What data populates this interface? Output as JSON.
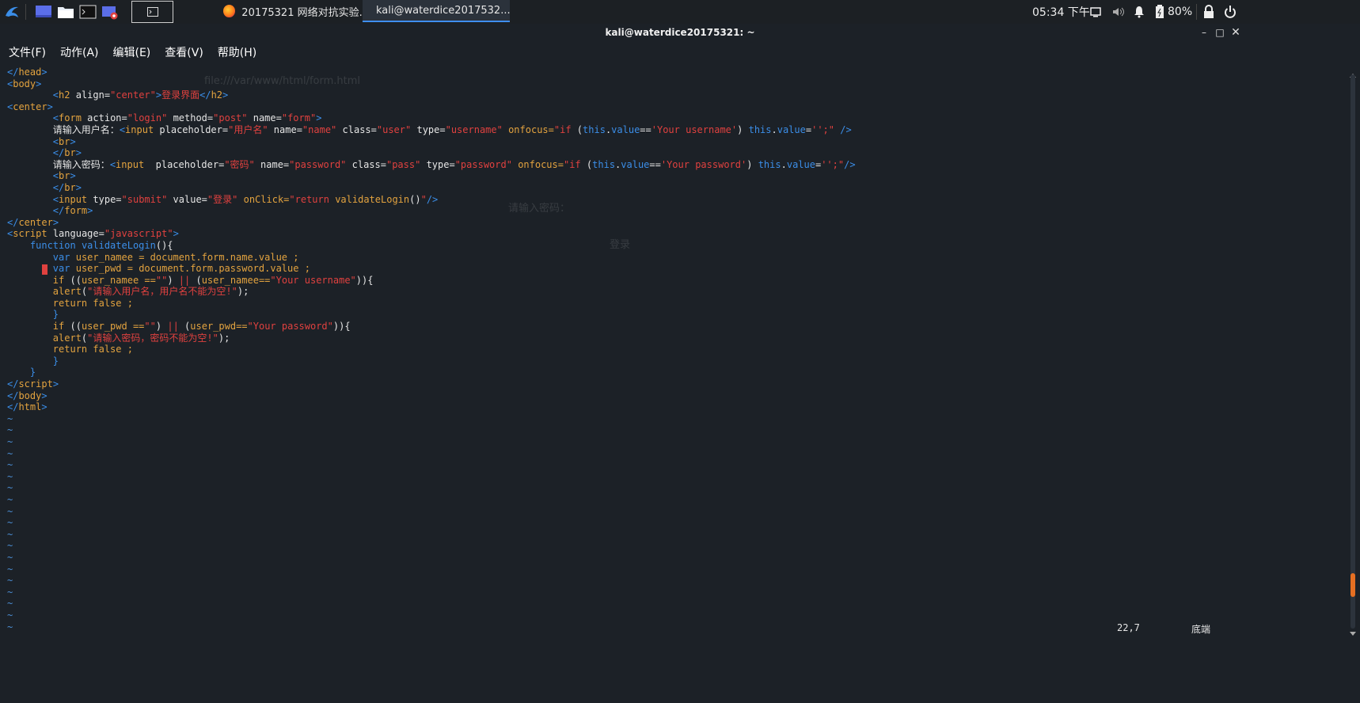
{
  "taskbar": {
    "tasks": [
      {
        "label": "20175321 网络对抗实验..."
      },
      {
        "label": "kali@waterdice2017532..."
      }
    ],
    "clock": "05:34 下午",
    "battery": "80%"
  },
  "window": {
    "title": "kali@waterdice20175321: ~"
  },
  "menu": [
    "文件(F)",
    "动作(A)",
    "编辑(E)",
    "查看(V)",
    "帮助(H)"
  ],
  "status": {
    "position": "22,7",
    "scroll": "底端"
  },
  "ghost": {
    "url": "file:///var/www/html/form.html",
    "label": "请输入密码：",
    "button": "登录"
  },
  "icons": [
    "kali-menu-icon",
    "desktop-icon",
    "files-icon",
    "terminal-icon",
    "screen-record-icon",
    "firefox-icon",
    "terminal-task-icon",
    "display-icon",
    "volume-icon",
    "bell-icon",
    "battery-icon",
    "lock-icon",
    "power-icon"
  ]
}
